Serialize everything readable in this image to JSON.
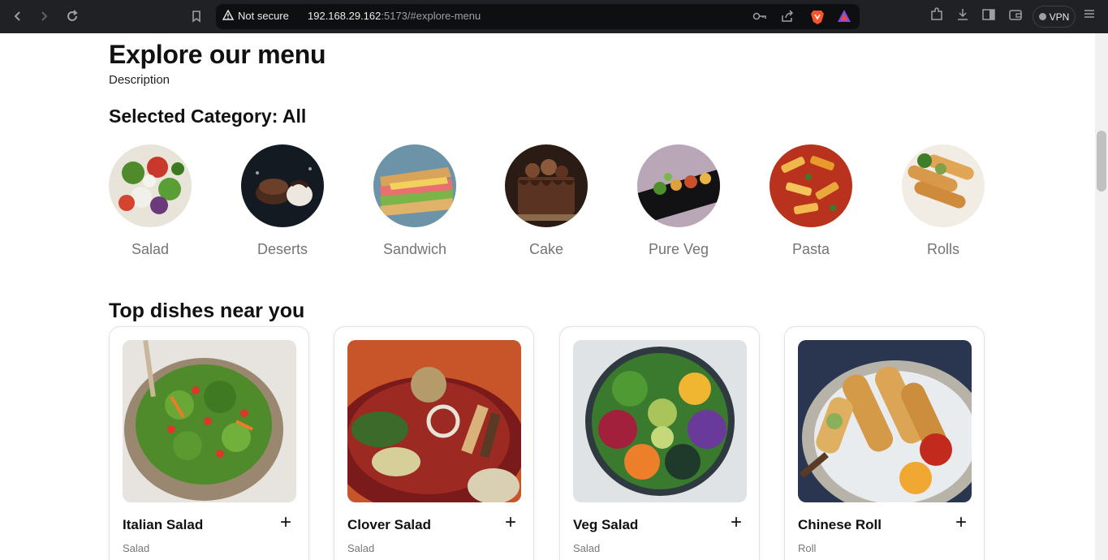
{
  "browser": {
    "security_label": "Not secure",
    "url_host": "192.168.29.162",
    "url_rest": ":5173/#explore-menu",
    "vpn_label": "VPN"
  },
  "explore": {
    "title": "Explore our menu",
    "description": "Description",
    "selected_label": "Selected Category: All"
  },
  "categories": [
    {
      "label": "Salad"
    },
    {
      "label": "Deserts"
    },
    {
      "label": "Sandwich"
    },
    {
      "label": "Cake"
    },
    {
      "label": "Pure Veg"
    },
    {
      "label": "Pasta"
    },
    {
      "label": "Rolls"
    }
  ],
  "top_dishes": {
    "title": "Top dishes near you",
    "add_symbol": "+",
    "items": [
      {
        "name": "Italian Salad",
        "category": "Salad"
      },
      {
        "name": "Clover Salad",
        "category": "Salad"
      },
      {
        "name": "Veg Salad",
        "category": "Salad"
      },
      {
        "name": "Chinese Roll",
        "category": "Roll"
      }
    ]
  },
  "colors": {
    "chrome_bg": "#202124",
    "category_label": "#747474",
    "text_primary": "#111111"
  }
}
